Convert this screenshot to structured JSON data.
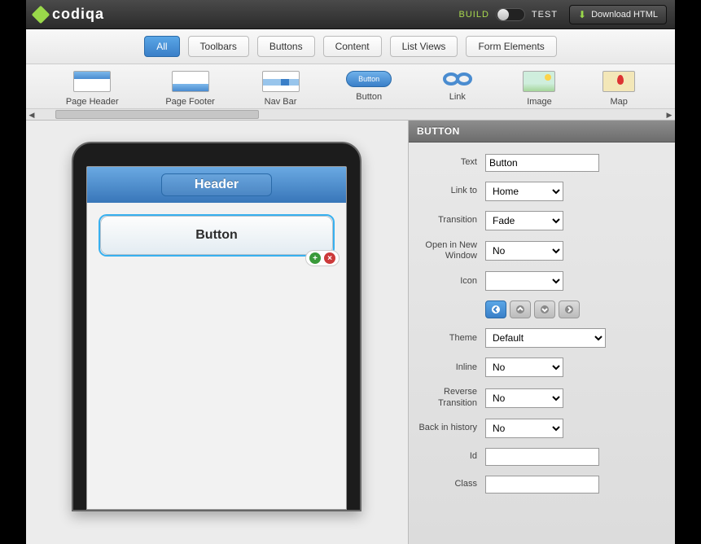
{
  "topbar": {
    "logo_text": "codiqa",
    "build_label": "BUILD",
    "test_label": "TEST",
    "download_label": "Download HTML"
  },
  "categories": {
    "items": [
      {
        "label": "All",
        "active": true
      },
      {
        "label": "Toolbars",
        "active": false
      },
      {
        "label": "Buttons",
        "active": false
      },
      {
        "label": "Content",
        "active": false
      },
      {
        "label": "List Views",
        "active": false
      },
      {
        "label": "Form Elements",
        "active": false
      }
    ]
  },
  "palette": {
    "items": [
      {
        "label": "Page Header"
      },
      {
        "label": "Page Footer"
      },
      {
        "label": "Nav Bar"
      },
      {
        "label": "Button",
        "badge": "Button"
      },
      {
        "label": "Link"
      },
      {
        "label": "Image"
      },
      {
        "label": "Map"
      }
    ]
  },
  "canvas": {
    "header_text": "Header",
    "button_text": "Button"
  },
  "props": {
    "title": "BUTTON",
    "labels": {
      "text": "Text",
      "link_to": "Link to",
      "transition": "Transition",
      "open_new": "Open in New Window",
      "icon": "Icon",
      "theme": "Theme",
      "inline": "Inline",
      "rev_trans": "Reverse Transition",
      "back_hist": "Back in history",
      "id": "Id",
      "class": "Class"
    },
    "values": {
      "text": "Button",
      "link_to": "Home",
      "transition": "Fade",
      "open_new": "No",
      "icon": "",
      "theme": "Default",
      "inline": "No",
      "rev_trans": "No",
      "back_hist": "No",
      "id": "",
      "class": ""
    }
  }
}
